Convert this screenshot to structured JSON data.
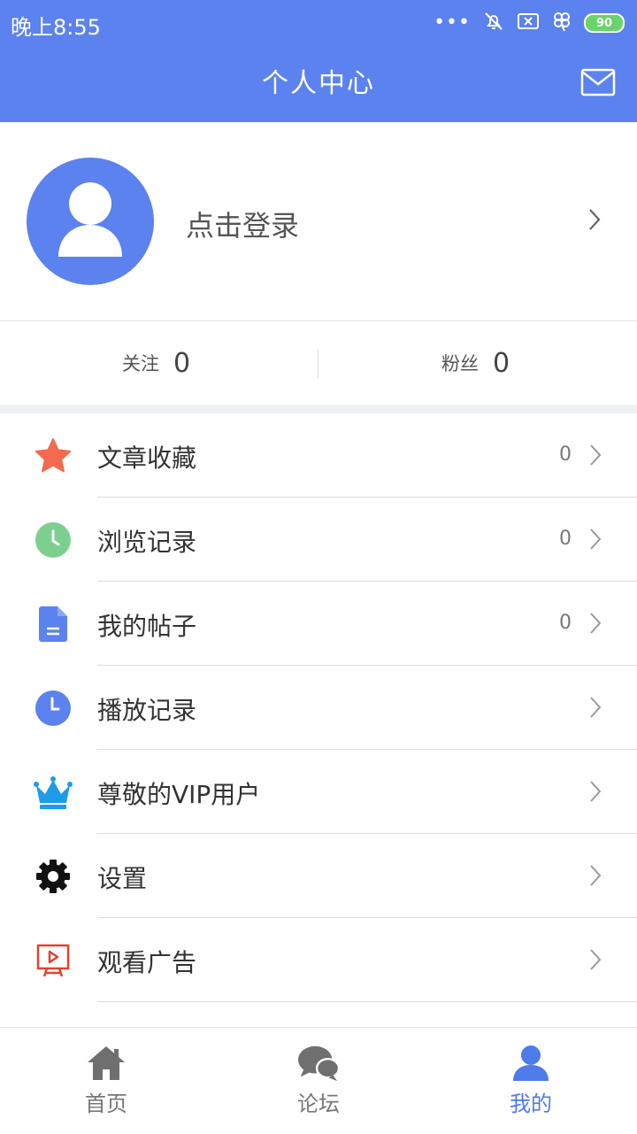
{
  "status_bar": {
    "time": "晚上8:55",
    "battery": "90",
    "dots": "•••"
  },
  "header": {
    "title": "个人中心"
  },
  "profile": {
    "login_text": "点击登录"
  },
  "stats": {
    "following_label": "关注",
    "following_value": "0",
    "fans_label": "粉丝",
    "fans_value": "0"
  },
  "menu": {
    "items": [
      {
        "label": "文章收藏",
        "count": "0",
        "icon": "star-icon",
        "color": "#f36a4f"
      },
      {
        "label": "浏览记录",
        "count": "0",
        "icon": "clock-icon",
        "color": "#7dcf8f"
      },
      {
        "label": "我的帖子",
        "count": "0",
        "icon": "document-icon",
        "color": "#5b82ef"
      },
      {
        "label": "播放记录",
        "count": "",
        "icon": "history-clock-icon",
        "color": "#5b82ef"
      },
      {
        "label": "尊敬的VIP用户",
        "count": "",
        "icon": "crown-icon",
        "color": "#1d9be8"
      },
      {
        "label": "设置",
        "count": "",
        "icon": "gear-icon",
        "color": "#111111"
      },
      {
        "label": "观看广告",
        "count": "",
        "icon": "ad-screen-icon",
        "color": "#e0442e"
      }
    ]
  },
  "tabbar": {
    "tabs": [
      {
        "label": "首页",
        "icon": "home-icon"
      },
      {
        "label": "论坛",
        "icon": "chat-bubbles-icon"
      },
      {
        "label": "我的",
        "icon": "user-icon"
      }
    ],
    "active": 2
  },
  "colors": {
    "brand": "#5b82ef",
    "active_tab": "#4d7be8",
    "divider": "#dedede",
    "battery": "#6ad36a"
  }
}
